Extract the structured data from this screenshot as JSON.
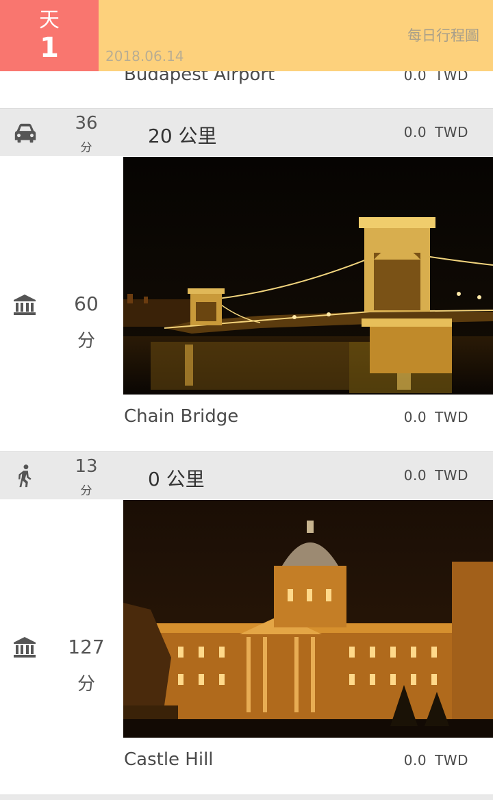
{
  "header": {
    "day_label": "天",
    "day_number": "1",
    "date": "2018.06.14",
    "daily_map_link": "每日行程圖"
  },
  "previous_place": {
    "name": "Budapest Airport",
    "price": "0.0",
    "currency": "TWD"
  },
  "transits": [
    {
      "mode_icon": "car-icon",
      "minutes": "36",
      "unit": "分",
      "distance": "20 公里",
      "price": "0.0",
      "currency": "TWD"
    },
    {
      "mode_icon": "walk-icon",
      "minutes": "13",
      "unit": "分",
      "distance": "0 公里",
      "price": "0.0",
      "currency": "TWD"
    }
  ],
  "places": [
    {
      "type_icon": "museum-icon",
      "minutes": "60",
      "unit": "分",
      "name": "Chain Bridge",
      "price": "0.0",
      "currency": "TWD"
    },
    {
      "type_icon": "museum-icon",
      "minutes": "127",
      "unit": "分",
      "name": "Castle Hill",
      "price": "0.0",
      "currency": "TWD"
    }
  ],
  "colors": {
    "day_box": "#f9766f",
    "header_bar": "#fdd17c",
    "transit_bg": "#e9e9e9"
  }
}
